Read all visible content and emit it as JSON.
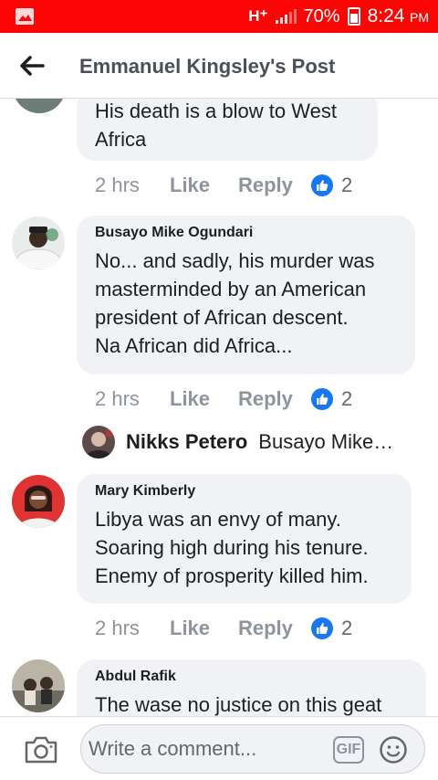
{
  "status_bar": {
    "network": "H⁺",
    "battery": "70%",
    "time": "8:24",
    "ampm": "PM"
  },
  "header": {
    "title": "Emmanuel Kingsley's Post"
  },
  "comments": [
    {
      "author": "",
      "text": "His death is a blow to West\nAfrica",
      "time": "2 hrs",
      "like_label": "Like",
      "reply_label": "Reply",
      "reactions": "2"
    },
    {
      "author": "Busayo Mike Ogundari",
      "text": "No... and sadly, his murder was\nmasterminded by an American\npresident of African descent.\nNa African did Africa...",
      "time": "2 hrs",
      "like_label": "Like",
      "reply_label": "Reply",
      "reactions": "2"
    },
    {
      "author": "Mary Kimberly",
      "text": "Libya was an envy of many.\nSoaring high during his tenure.\nEnemy of prosperity killed him.",
      "time": "2 hrs",
      "like_label": "Like",
      "reply_label": "Reply",
      "reactions": "2"
    },
    {
      "author": "Abdul Rafik",
      "text": "The wase no justice on this geat"
    }
  ],
  "reply_preview": {
    "name": "Nikks Petero",
    "text": "Busayo Mike…"
  },
  "composer": {
    "placeholder": "Write a comment...",
    "gif_label": "GIF"
  },
  "colors": {
    "status_bar": "#fb0505",
    "like_blue": "#1877f2",
    "bubble": "#f0f2f5",
    "muted_text": "#8d949e"
  },
  "icons": {
    "back": "arrow-left-icon",
    "camera": "camera-icon",
    "emoji": "smiley-icon",
    "like": "thumbs-up-icon"
  }
}
